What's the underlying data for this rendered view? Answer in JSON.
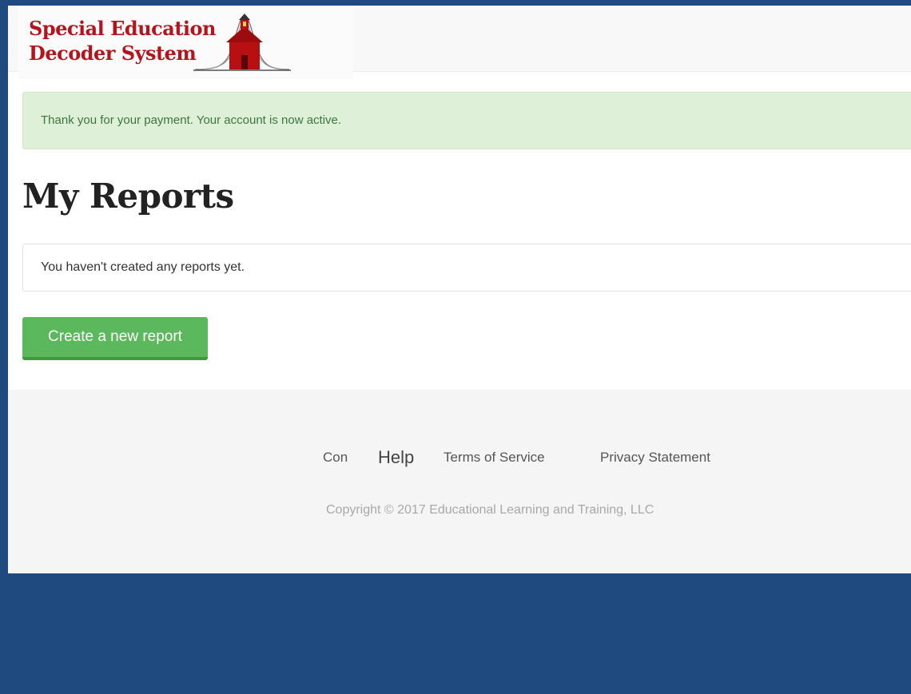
{
  "brand": {
    "line1": "Special Education",
    "line2": "Decoder System",
    "logo_icon": "schoolhouse-bell-curve-icon"
  },
  "alert": {
    "message": "Thank you for your payment. Your account is now active."
  },
  "page_title": "My Reports",
  "reports_panel": {
    "empty_message": "You haven't created any reports yet."
  },
  "actions": {
    "create_report_label": "Create a new report"
  },
  "footer": {
    "links": [
      "Con",
      "Help",
      "Terms of Service",
      "Privacy Statement"
    ],
    "copyright": "Copyright © 2017 Educational Learning and Training, LLC"
  },
  "colors": {
    "frame_background": "#1f4a80",
    "brand_red": "#b4151c",
    "alert_background": "#dff0d8",
    "alert_text": "#3c763d",
    "button_green": "#5cb85c"
  }
}
